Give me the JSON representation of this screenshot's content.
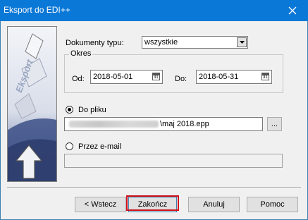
{
  "window": {
    "title": "Eksport do EDI++"
  },
  "side_image": {
    "text": "Eksport"
  },
  "document_type": {
    "label": "Dokumenty typu:",
    "value": "wszystkie"
  },
  "period": {
    "legend": "Okres",
    "from_label": "Od:",
    "from_value": "2018-05-01",
    "to_label": "Do:",
    "to_value": "2018-05-31",
    "calendar_glyph": "31"
  },
  "to_file": {
    "label": "Do pliku",
    "path_suffix": "\\maj 2018.epp",
    "browse_label": "..."
  },
  "email": {
    "label": "Przez e-mail",
    "value": ""
  },
  "buttons": {
    "back": "< Wstecz",
    "finish": "Zakończ",
    "cancel": "Anuluj",
    "help": "Pomoc"
  },
  "colors": {
    "titlebar": "#0a78d7",
    "highlight": "#d0121b"
  }
}
